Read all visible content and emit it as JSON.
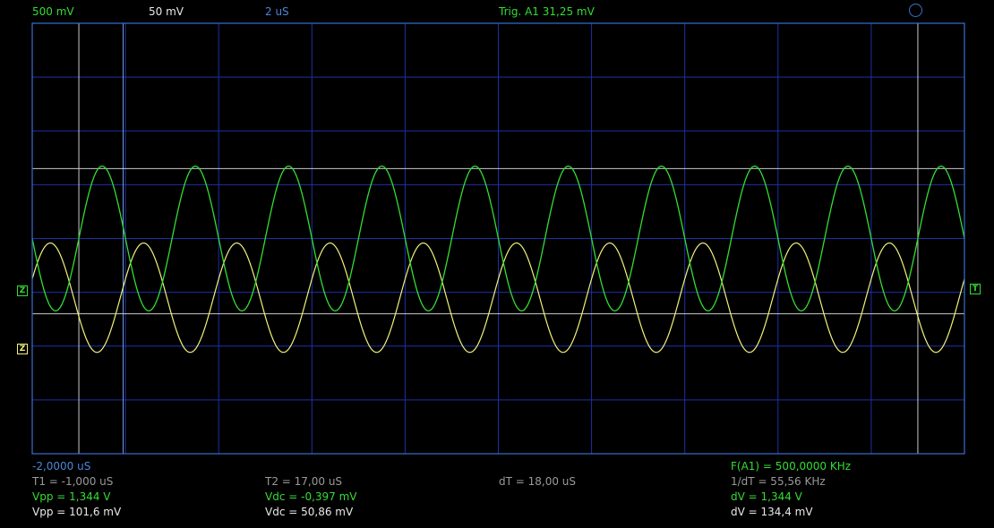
{
  "header": {
    "ch1_scale": "500 mV",
    "ch2_scale": "50 mV",
    "timebase": "2 uS",
    "trigger": "Trig. A1  31,25 mV"
  },
  "markers": {
    "ch1_ground": "Z",
    "ch2_ground": "Z",
    "trigger_level": "T"
  },
  "footer": {
    "offset": "-2,0000 uS",
    "t1": "T1 = -1,000 uS",
    "t2": "T2 = 17,00 uS",
    "dt": "dT = 18,00 uS",
    "freq": "F(A1) = 500,0000 KHz",
    "inv_dt": "1/dT = 55,56 KHz",
    "ch1_vpp": "Vpp = 1,344 V",
    "ch1_vdc": "Vdc = -0,397 mV",
    "ch1_dv": "dV = 1,344 V",
    "ch2_vpp": "Vpp = 101,6 mV",
    "ch2_vdc": "Vdc = 50,86 mV",
    "ch2_dv": "dV = 134,4 mV"
  },
  "colors": {
    "ch1": "#33dd33",
    "ch2": "#f2f27a",
    "grid": "#1f2fa8",
    "border": "#3a6fd0",
    "cursor": "#c8c8c8",
    "cursor_alt": "#6aa0e0",
    "background": "#000000"
  },
  "chart_data": {
    "type": "line",
    "x_unit": "uS",
    "time_per_div": 2,
    "x_start": -2.0,
    "xlim": [
      -2,
      18
    ],
    "series": [
      {
        "channel": "ch1",
        "volts_per_div": 0.5,
        "ground_div_offset": 0,
        "shape": "sine",
        "frequency_khz": 500,
        "vpp": 1.344,
        "phase_deg": 180
      },
      {
        "channel": "ch2",
        "volts_per_div": 0.05,
        "ground_div_offset": -1.1,
        "shape": "sine",
        "frequency_khz": 500,
        "vpp": 0.1016,
        "phase_deg": 20
      }
    ],
    "cursors_time": [
      -1.0,
      17.0
    ],
    "reference_time": -0.05,
    "cursor_levels_div": [
      1.3,
      -1.4
    ]
  }
}
